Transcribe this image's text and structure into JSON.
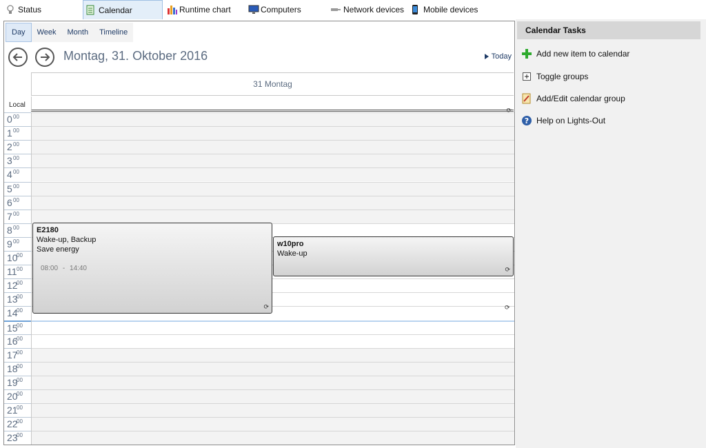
{
  "top_tabs": [
    {
      "label": "Status",
      "icon": "bulb-icon"
    },
    {
      "label": "Calendar",
      "icon": "calendar-icon",
      "active": true
    },
    {
      "label": "Runtime chart",
      "icon": "bar-chart-icon"
    },
    {
      "label": "Computers",
      "icon": "monitor-icon"
    },
    {
      "label": "Network devices",
      "icon": "network-plug-icon"
    },
    {
      "label": "Mobile devices",
      "icon": "mobile-phone-icon"
    }
  ],
  "calendar": {
    "views": [
      "Day",
      "Week",
      "Month",
      "Timeline"
    ],
    "active_view": "Day",
    "date_title": "Montag, 31. Oktober 2016",
    "today_label": "Today",
    "day_header": "31 Montag",
    "timezone_label": "Local",
    "hours": [
      "0",
      "1",
      "2",
      "3",
      "4",
      "5",
      "6",
      "7",
      "8",
      "9",
      "10",
      "11",
      "12",
      "13",
      "14",
      "15",
      "16",
      "17",
      "18",
      "19",
      "20",
      "21",
      "22",
      "23"
    ],
    "minutes_suffix": "00",
    "appointments": [
      {
        "title": "E2180",
        "line1": "Wake-up, Backup",
        "line2": "Save energy",
        "start": "08:00",
        "end": "14:40",
        "time_sep": "-"
      },
      {
        "title": "w10pro",
        "line1": "Wake-up",
        "line2": "",
        "start": "09:00",
        "end": "11:00"
      }
    ]
  },
  "tasks": {
    "header": "Calendar Tasks",
    "items": [
      {
        "label": "Add new item to calendar",
        "icon": "plus-icon"
      },
      {
        "label": "Toggle groups",
        "icon": "toggle-groups-icon"
      },
      {
        "label": "Add/Edit calendar group",
        "icon": "edit-group-icon"
      },
      {
        "label": "Help on Lights-Out",
        "icon": "help-icon"
      }
    ]
  },
  "colors": {
    "accent": "#1f3b66",
    "plus": "#2eaa2e",
    "help": "#2f5fa8"
  }
}
